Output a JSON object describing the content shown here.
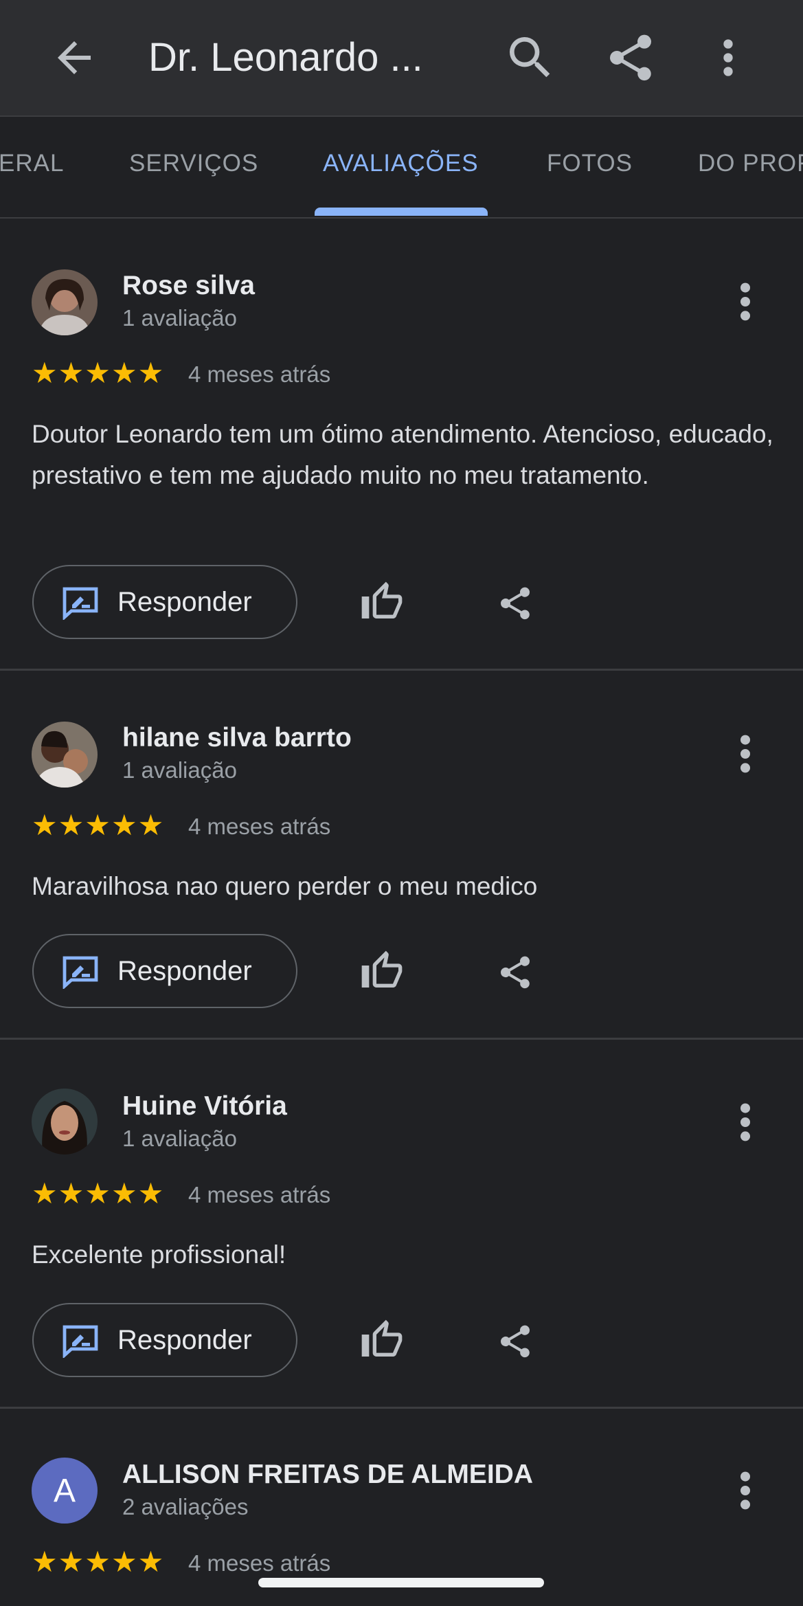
{
  "appbar": {
    "title": "Dr. Leonardo ...",
    "icons": [
      "arrow-back-icon",
      "search-icon",
      "share-icon",
      "more-vert-icon"
    ]
  },
  "tabs": [
    {
      "label": "ERAL"
    },
    {
      "label": "SERVIÇOS"
    },
    {
      "label": "AVALIAÇÕES",
      "active": true
    },
    {
      "label": "FOTOS"
    },
    {
      "label": "DO PROF"
    }
  ],
  "colors": {
    "accent": "#8ab4f8",
    "star": "#fbbc04",
    "background": "#202124",
    "appbar": "#2d2e31"
  },
  "reviews": [
    {
      "name": "Rose silva",
      "count": "1 avaliação",
      "stars": "★★★★★",
      "rating": 5,
      "time": "4 meses atrás",
      "text": "Doutor Leonardo tem um ótimo atendimento. Atencioso, educado, prestativo e tem me ajudado muito no meu tratamento.",
      "reply_label": "Responder"
    },
    {
      "name": "hilane silva barrto",
      "count": "1 avaliação",
      "stars": "★★★★★",
      "rating": 5,
      "time": "4 meses atrás",
      "text": "Maravilhosa nao quero perder o meu medico",
      "reply_label": "Responder"
    },
    {
      "name": "Huine Vitória",
      "count": "1 avaliação",
      "stars": "★★★★★",
      "rating": 5,
      "time": "4 meses atrás",
      "text": "Excelente profissional!",
      "reply_label": "Responder"
    },
    {
      "name": "ALLISON FREITAS DE ALMEIDA",
      "count": "2 avaliações",
      "avatar_letter": "A",
      "stars": "★★★★★",
      "rating": 5,
      "time": "4 meses atrás"
    }
  ]
}
